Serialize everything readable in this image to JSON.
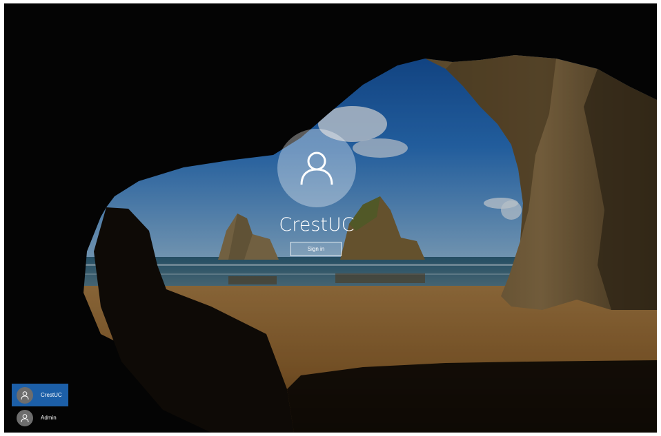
{
  "login": {
    "username": "CrestUC",
    "sign_in_label": "Sign in"
  },
  "user_list": [
    {
      "label": "CrestUC",
      "selected": true
    },
    {
      "label": "Admin",
      "selected": false
    }
  ],
  "icons": {
    "main_avatar": "user-icon",
    "list_avatar": "user-icon"
  },
  "colors": {
    "selected_user_bg": "#1c5fa8",
    "avatar_bg": "#6d6d6d"
  }
}
